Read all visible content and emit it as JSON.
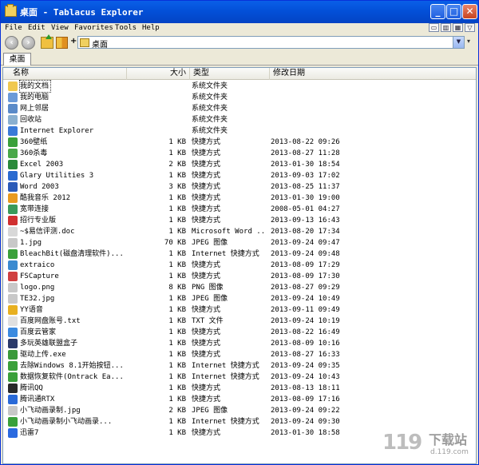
{
  "window": {
    "title": "桌面 - Tablacus Explorer",
    "controls": {
      "minimize": "_",
      "maximize": "□",
      "close": "✕"
    }
  },
  "menu": [
    "File",
    "Edit",
    "View",
    "Favorites",
    "Tools",
    "Help"
  ],
  "nav": {
    "address": "桌面"
  },
  "tabs": [
    "桌面"
  ],
  "columns": {
    "name": "名称",
    "size": "大小",
    "type": "类型",
    "date": "修改日期"
  },
  "files": [
    {
      "name": "我的文档",
      "size": "",
      "type": "系统文件夹",
      "date": "",
      "icon": "folder-docs",
      "color": "#f0c850"
    },
    {
      "name": "我的电脑",
      "size": "",
      "type": "系统文件夹",
      "date": "",
      "icon": "computer",
      "color": "#6a9ad8"
    },
    {
      "name": "网上邻居",
      "size": "",
      "type": "系统文件夹",
      "date": "",
      "icon": "network",
      "color": "#5a8ac8"
    },
    {
      "name": "回收站",
      "size": "",
      "type": "系统文件夹",
      "date": "",
      "icon": "recycle-bin",
      "color": "#8ab0d0"
    },
    {
      "name": "Internet Explorer",
      "size": "",
      "type": "系统文件夹",
      "date": "",
      "icon": "ie",
      "color": "#3a7ad8"
    },
    {
      "name": "360壁纸",
      "size": "1 KB",
      "type": "快捷方式",
      "date": "2013-08-22 09:26",
      "icon": "app",
      "color": "#3aa03a"
    },
    {
      "name": "360杀毒",
      "size": "1 KB",
      "type": "快捷方式",
      "date": "2013-08-27 11:28",
      "icon": "shield",
      "color": "#48a848"
    },
    {
      "name": "Excel 2003",
      "size": "2 KB",
      "type": "快捷方式",
      "date": "2013-01-30 18:54",
      "icon": "excel",
      "color": "#2a8a3a"
    },
    {
      "name": "Glary Utilities 3",
      "size": "1 KB",
      "type": "快捷方式",
      "date": "2013-09-03 17:02",
      "icon": "app",
      "color": "#2a6ad0"
    },
    {
      "name": "Word 2003",
      "size": "3 KB",
      "type": "快捷方式",
      "date": "2013-08-25 11:37",
      "icon": "word",
      "color": "#2a5ab8"
    },
    {
      "name": "酷我音乐 2012",
      "size": "1 KB",
      "type": "快捷方式",
      "date": "2013-01-30 19:00",
      "icon": "music",
      "color": "#e89a20"
    },
    {
      "name": "宽带连接",
      "size": "1 KB",
      "type": "快捷方式",
      "date": "2008-05-01 04:27",
      "icon": "network",
      "color": "#3a9a5a"
    },
    {
      "name": "招行专业版",
      "size": "1 KB",
      "type": "快捷方式",
      "date": "2013-09-13 16:43",
      "icon": "bank",
      "color": "#d03030"
    },
    {
      "name": "~$易信评测.doc",
      "size": "1 KB",
      "type": "Microsoft Word ...",
      "date": "2013-08-20 17:34",
      "icon": "doc",
      "color": "#d8d8d8"
    },
    {
      "name": "1.jpg",
      "size": "70 KB",
      "type": "JPEG 图像",
      "date": "2013-09-24 09:47",
      "icon": "image",
      "color": "#c8c8c8"
    },
    {
      "name": "BleachBit(磁盘清理软件)...",
      "size": "1 KB",
      "type": "Internet 快捷方式",
      "date": "2013-09-24 09:48",
      "icon": "link",
      "color": "#3aa03a"
    },
    {
      "name": "extraico",
      "size": "1 KB",
      "type": "快捷方式",
      "date": "2013-08-09 17:29",
      "icon": "app",
      "color": "#3a8ad0"
    },
    {
      "name": "FSCapture",
      "size": "1 KB",
      "type": "快捷方式",
      "date": "2013-08-09 17:30",
      "icon": "app",
      "color": "#d04040"
    },
    {
      "name": "logo.png",
      "size": "8 KB",
      "type": "PNG 图像",
      "date": "2013-08-27 09:29",
      "icon": "image",
      "color": "#c8c8c8"
    },
    {
      "name": "TE32.jpg",
      "size": "1 KB",
      "type": "JPEG 图像",
      "date": "2013-09-24 10:49",
      "icon": "image",
      "color": "#c8c8c8"
    },
    {
      "name": "YY语音",
      "size": "1 KB",
      "type": "快捷方式",
      "date": "2013-09-11 09:49",
      "icon": "app",
      "color": "#e8b020"
    },
    {
      "name": "百度网盘账号.txt",
      "size": "1 KB",
      "type": "TXT 文件",
      "date": "2013-09-24 10:19",
      "icon": "text",
      "color": "#e0e0e0"
    },
    {
      "name": "百度云管家",
      "size": "1 KB",
      "type": "快捷方式",
      "date": "2013-08-22 16:49",
      "icon": "cloud",
      "color": "#3a8ae0"
    },
    {
      "name": "多玩英雄联盟盒子",
      "size": "1 KB",
      "type": "快捷方式",
      "date": "2013-08-09 10:16",
      "icon": "game",
      "color": "#2a3a6a"
    },
    {
      "name": "驱动上传.exe",
      "size": "1 KB",
      "type": "快捷方式",
      "date": "2013-08-27 16:33",
      "icon": "exe",
      "color": "#3a9a3a"
    },
    {
      "name": "去除Windows 8.1开始按钮...",
      "size": "1 KB",
      "type": "Internet 快捷方式",
      "date": "2013-09-24 09:35",
      "icon": "link",
      "color": "#3aa03a"
    },
    {
      "name": "数据恢复软件(Ontrack Ea...",
      "size": "1 KB",
      "type": "Internet 快捷方式",
      "date": "2013-09-24 10:43",
      "icon": "link",
      "color": "#3aa03a"
    },
    {
      "name": "腾讯QQ",
      "size": "1 KB",
      "type": "快捷方式",
      "date": "2013-08-13 18:11",
      "icon": "qq",
      "color": "#2a2a2a"
    },
    {
      "name": "腾讯通RTX",
      "size": "1 KB",
      "type": "快捷方式",
      "date": "2013-08-09 17:16",
      "icon": "app",
      "color": "#2a6ad8"
    },
    {
      "name": "小飞动画录制.jpg",
      "size": "2 KB",
      "type": "JPEG 图像",
      "date": "2013-09-24 09:22",
      "icon": "image",
      "color": "#c8c8c8"
    },
    {
      "name": "小飞动画录制小飞动画录...",
      "size": "1 KB",
      "type": "Internet 快捷方式",
      "date": "2013-09-24 09:30",
      "icon": "link",
      "color": "#3aa03a"
    },
    {
      "name": "迅雷7",
      "size": "1 KB",
      "type": "快捷方式",
      "date": "2013-01-30 18:58",
      "icon": "thunder",
      "color": "#2a6ae0"
    }
  ],
  "watermark": {
    "logo": "119",
    "cn": "下载站",
    "url": "d.119.com"
  }
}
